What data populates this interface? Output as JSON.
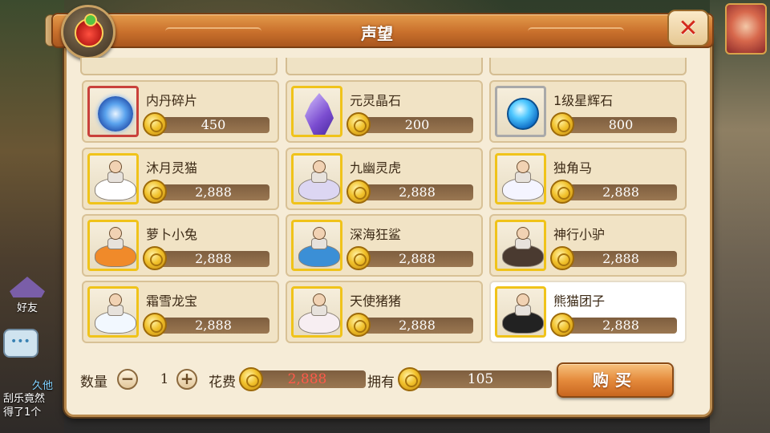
{
  "dialog": {
    "title": "声望",
    "close_icon": "close-x-icon",
    "emblem_icon": "reputation-emblem-icon"
  },
  "items": [
    {
      "name": "内丹碎片",
      "price": "450",
      "icon": "inner-core-shard-icon",
      "frame": "red"
    },
    {
      "name": "元灵晶石",
      "price": "200",
      "icon": "spirit-crystal-icon",
      "frame": "gold"
    },
    {
      "name": "1级星辉石",
      "price": "800",
      "icon": "star-gem-icon",
      "frame": "gray"
    },
    {
      "name": "沐月灵猫",
      "price": "2,888",
      "icon": "moon-cat-mount-icon",
      "frame": "gold"
    },
    {
      "name": "九幽灵虎",
      "price": "2,888",
      "icon": "spirit-tiger-mount-icon",
      "frame": "gold"
    },
    {
      "name": "独角马",
      "price": "2,888",
      "icon": "unicorn-mount-icon",
      "frame": "gold"
    },
    {
      "name": "萝卜小兔",
      "price": "2,888",
      "icon": "carrot-rabbit-mount-icon",
      "frame": "gold"
    },
    {
      "name": "深海狂鲨",
      "price": "2,888",
      "icon": "shark-mount-icon",
      "frame": "gold"
    },
    {
      "name": "神行小驴",
      "price": "2,888",
      "icon": "donkey-mount-icon",
      "frame": "gold"
    },
    {
      "name": "霜雪龙宝",
      "price": "2,888",
      "icon": "snow-dragon-mount-icon",
      "frame": "gold"
    },
    {
      "name": "天使猪猪",
      "price": "2,888",
      "icon": "angel-pig-mount-icon",
      "frame": "gold"
    },
    {
      "name": "熊猫团子",
      "price": "2,888",
      "icon": "panda-mount-icon",
      "frame": "gold",
      "selected": true
    }
  ],
  "purchase": {
    "quantity_label": "数量",
    "quantity": "1",
    "cost_label": "花费",
    "cost": "2,888",
    "owned_label": "拥有",
    "owned": "105",
    "buy_label": "购买"
  },
  "side": {
    "friends_label": "好友",
    "chat_lines": [
      "久他",
      "刮乐竟然",
      "得了1个"
    ]
  },
  "colors": {
    "panel_bg": "#f6ecd7",
    "title_bar": "#c9702c",
    "price_bar": "#8a6a47",
    "cost_text": "#e0322a",
    "gold_frame": "#f0c31a"
  }
}
